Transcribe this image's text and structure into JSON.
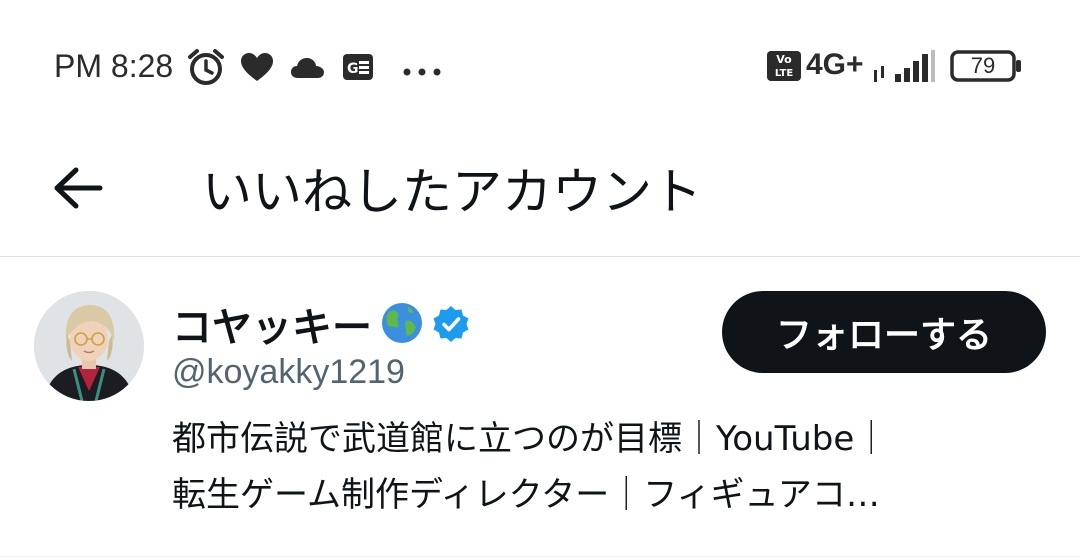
{
  "status_bar": {
    "time": "PM 8:28",
    "icons_left": [
      "alarm-icon",
      "heart-icon",
      "cloud-icon",
      "gboard-icon",
      "more-dots-icon"
    ],
    "volte_label": "Vo LTE",
    "network": "4G+",
    "battery_level": "79"
  },
  "header": {
    "title": "いいねしたアカウント",
    "back_icon": "arrow-left-icon"
  },
  "account": {
    "display_name": "コヤッキー",
    "name_emoji": "🌏",
    "verified": true,
    "handle": "@koyakky1219",
    "follow_label": "フォローする",
    "bio_line1": "都市伝説で武道館に立つのが目標｜YouTube｜",
    "bio_line2": "転生ゲーム制作ディレクター｜フィギュアコ…"
  },
  "colors": {
    "text_primary": "#0f1419",
    "text_secondary": "#536471",
    "verified_blue": "#1d9bf0",
    "button_bg": "#0f1419",
    "divider": "#e1e4e6"
  }
}
